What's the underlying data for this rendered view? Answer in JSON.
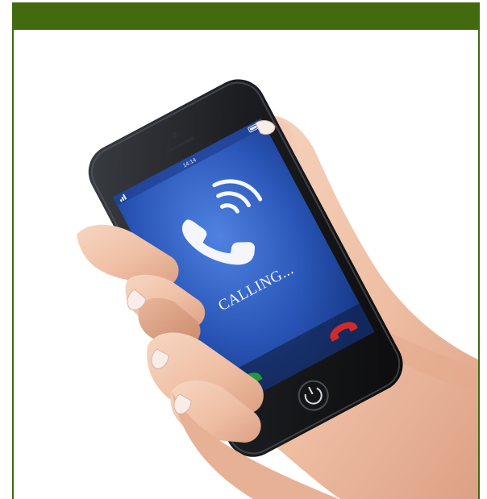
{
  "header": {
    "title": ""
  },
  "photo": {
    "subject": "",
    "phone": {
      "status_time": "14:14",
      "call_status": "CALLING...",
      "screen_color": "#2a56b8",
      "accept_color": "#1f9a3c",
      "decline_color": "#d22a2a",
      "icons": [
        "phone-handset-icon",
        "signal-waves-icon",
        "accept-call-icon",
        "decline-call-icon",
        "home-button-icon"
      ]
    }
  }
}
